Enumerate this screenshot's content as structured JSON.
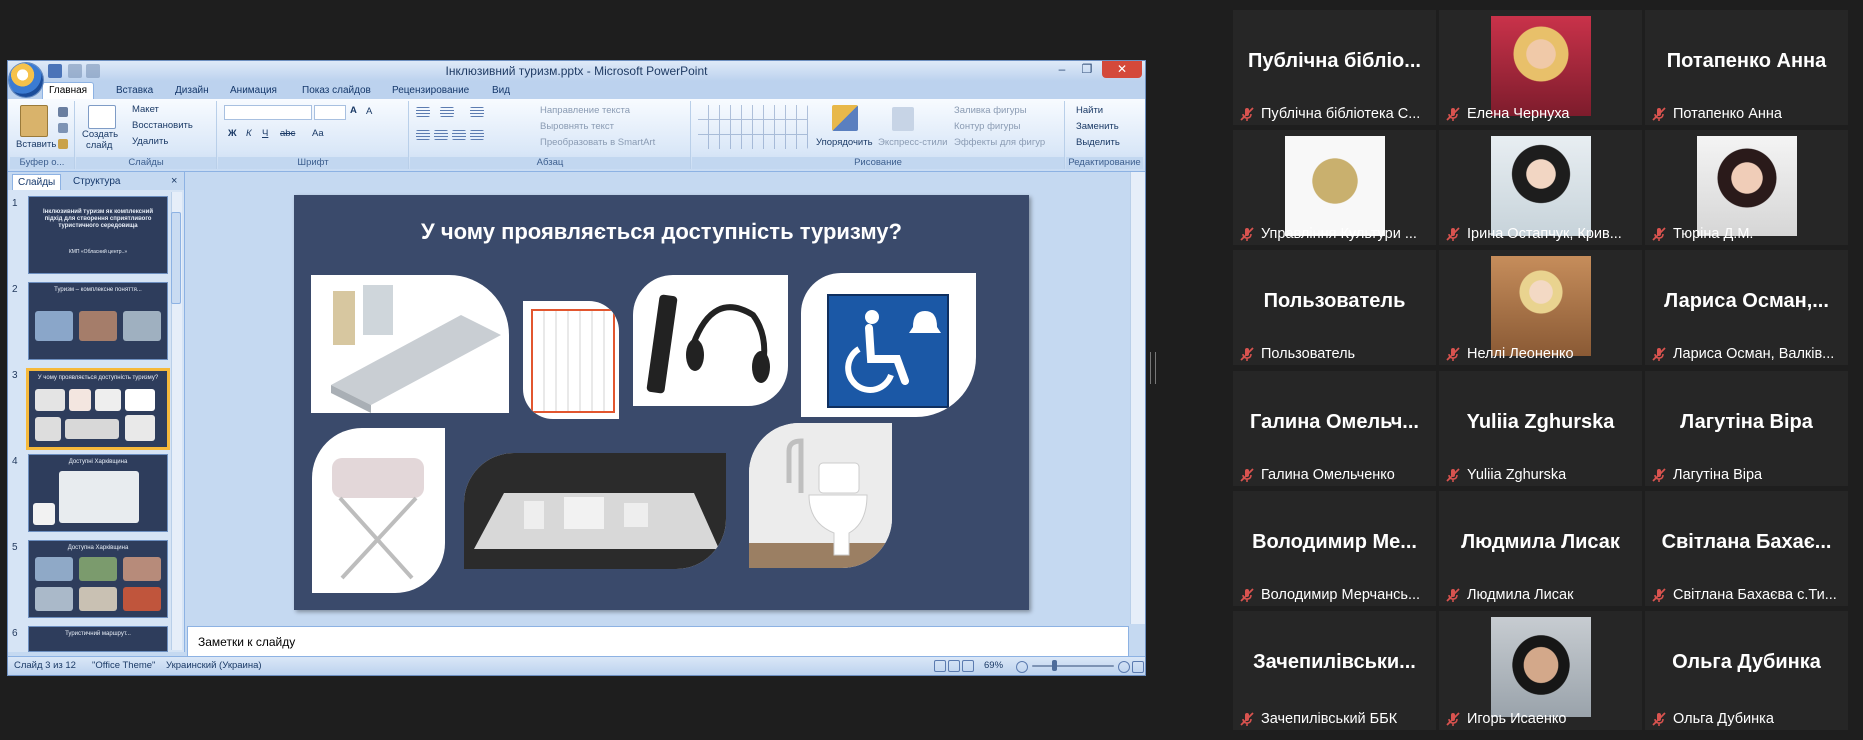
{
  "powerpoint": {
    "window_title": "Інклюзивний туризм.pptx - Microsoft PowerPoint",
    "window_controls": {
      "minimize": "–",
      "maximize": "❐",
      "close": "✕"
    },
    "tabs": [
      "Главная",
      "Вставка",
      "Дизайн",
      "Анимация",
      "Показ слайдов",
      "Рецензирование",
      "Вид"
    ],
    "active_tab": "Главная",
    "ribbon": {
      "clipboard": {
        "paste": "Вставить",
        "label": "Буфер о..."
      },
      "slides": {
        "new_slide_1": "Создать",
        "new_slide_2": "слайд",
        "layout": "Макет",
        "reset": "Восстановить",
        "delete": "Удалить",
        "label": "Слайды"
      },
      "font": {
        "label": "Шрифт"
      },
      "paragraph": {
        "text_direction": "Направление текста",
        "align_text": "Выровнять текст",
        "smartart": "Преобразовать в SmartArt",
        "label": "Абзац"
      },
      "drawing": {
        "arrange": "Упорядочить",
        "quick_styles": "Экспресс-стили",
        "shape_fill": "Заливка фигуры",
        "shape_outline": "Контур фигуры",
        "shape_effects": "Эффекты для фигур",
        "label": "Рисование"
      },
      "editing": {
        "find": "Найти",
        "replace": "Заменить",
        "select": "Выделить",
        "label": "Редактирование"
      }
    },
    "pane_tabs": [
      "Слайды",
      "Структура"
    ],
    "thumbnails": [
      {
        "num": "1",
        "title": "Інклюзивний туризм як комплексний підхід для створення сприятливого туристичного середовища",
        "sub": "КМП «Обласний центр..»"
      },
      {
        "num": "2",
        "title": "Туризм – комплексне поняття..."
      },
      {
        "num": "3",
        "title": "У чому проявляється доступність туризму?"
      },
      {
        "num": "4",
        "title": "Доступні Харківщина"
      },
      {
        "num": "5",
        "title": "Доступна Харківщина"
      },
      {
        "num": "6",
        "title": "Туристичний маршрут..."
      }
    ],
    "slide_title": "У чому проявляється доступність туризму?",
    "notes_placeholder": "Заметки к слайду",
    "status": {
      "slide_counter": "Слайд 3 из 12",
      "theme": "\"Office Theme\"",
      "language": "Украинский (Украина)",
      "zoom": "69%"
    }
  },
  "participants": [
    {
      "display": "Публічна бібліо...",
      "name": "Публічна бібліотека С...",
      "photo": null
    },
    {
      "display": "",
      "name": "Елена Чернуха",
      "photo": "woman-red"
    },
    {
      "display": "Потапенко Анна",
      "name": "Потапенко Анна",
      "photo": null
    },
    {
      "display": "",
      "name": "Управління Культури ...",
      "photo": "logo"
    },
    {
      "display": "",
      "name": "Ірина Остапчук, Крив...",
      "photo": "woman-dark"
    },
    {
      "display": "",
      "name": "Тюріна Д.М.",
      "photo": "woman-red2"
    },
    {
      "display": "Пользователь",
      "name": "Пользователь",
      "photo": null
    },
    {
      "display": "",
      "name": "Неллі Леоненко",
      "photo": "woman-office"
    },
    {
      "display": "Лариса Осман,...",
      "name": "Лариса Осман, Валків...",
      "photo": null
    },
    {
      "display": "Галина Омельч...",
      "name": "Галина Омельченко",
      "photo": null
    },
    {
      "display": "Yuliia Zghurska",
      "name": "Yuliia Zghurska",
      "photo": null
    },
    {
      "display": "Лагутіна Віра",
      "name": "Лагутіна Віра",
      "photo": null
    },
    {
      "display": "Володимир Ме...",
      "name": "Володимир Мерчансь...",
      "photo": null
    },
    {
      "display": "Людмила Лисак",
      "name": "Людмила Лисак",
      "photo": null
    },
    {
      "display": "Світлана Бахає...",
      "name": "Світлана Бахаєва с.Ти...",
      "photo": null
    },
    {
      "display": "Зачепилівськи...",
      "name": "Зачепилівський ББК",
      "photo": null
    },
    {
      "display": "",
      "name": "Игорь Исаенко",
      "photo": "man-glasses"
    },
    {
      "display": "Ольга Дубинка",
      "name": "Ольга Дубинка",
      "photo": null
    }
  ]
}
